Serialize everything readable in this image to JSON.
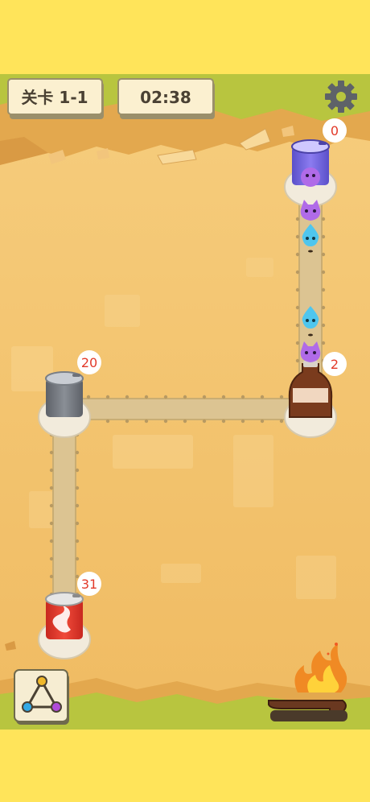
{
  "level": {
    "label": "关卡 1-1"
  },
  "timer": {
    "value": "02:38"
  },
  "icons": {
    "settings": "gear-icon",
    "network": "triangle-network-icon",
    "fire": "fire-icon"
  },
  "stations": [
    {
      "name": "purple-can",
      "count": "0"
    },
    {
      "name": "cola-bottle",
      "count": "2"
    },
    {
      "name": "gray-can",
      "count": "20"
    },
    {
      "name": "red-can",
      "count": "31"
    }
  ],
  "colors": {
    "frame": "#ffe45a",
    "sand": "#f4c46d",
    "track": "#dcc492",
    "grass": "#b8c53f",
    "purple_blob": "#b06be8",
    "blue_blob": "#4fc6ee",
    "badge_text": "#e23a2a"
  }
}
